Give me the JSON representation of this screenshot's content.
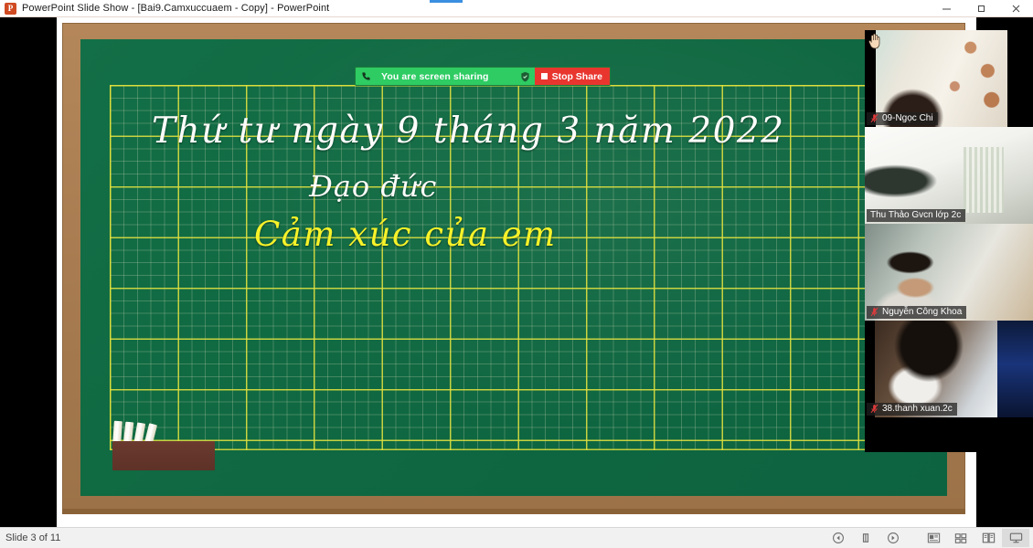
{
  "window": {
    "app_icon": "powerpoint-icon",
    "title": "PowerPoint Slide Show  -  [Bai9.Camxuccuaem - Copy] - PowerPoint",
    "minimize_label": "Minimize",
    "restore_label": "Restore",
    "close_label": "Close"
  },
  "share_toolbar": {
    "phone_icon": "phone-icon",
    "status_text": "You are screen sharing",
    "shield_icon": "shield-icon",
    "stop_label": "Stop Share",
    "green_color": "#2ecc63",
    "red_color": "#e8362f"
  },
  "slide": {
    "line1": "Thứ tư ngày 9 tháng 3 năm 2022",
    "line2": "Đạo đức",
    "line3": "Cảm xúc của em",
    "line1_color": "#fdfdfb",
    "line2_color": "#fdfdfb",
    "line3_color": "#f7f229",
    "board_color": "#0f6a42",
    "frame_color": "#a87c50",
    "grid_color": "#e1e13c"
  },
  "participants": [
    {
      "name": "09-Ngọc Chi",
      "mic_icon": "mic-muted-icon",
      "hand_icon": "raised-hand-icon",
      "raised_hand": true,
      "active_speaker": false
    },
    {
      "name": "Thu Thảo Gvcn lớp 2c",
      "mic_icon": "",
      "hand_icon": "",
      "raised_hand": false,
      "active_speaker": true
    },
    {
      "name": "Nguyễn Công Khoa",
      "mic_icon": "mic-muted-icon",
      "hand_icon": "",
      "raised_hand": false,
      "active_speaker": true
    },
    {
      "name": "38.thanh xuan.2c",
      "mic_icon": "mic-muted-icon",
      "hand_icon": "",
      "raised_hand": false,
      "active_speaker": false
    }
  ],
  "statusbar": {
    "slide_text": "Slide 3 of 11",
    "icons": [
      {
        "name": "previous-slide-icon",
        "label": "Previous"
      },
      {
        "name": "pen-menu-icon",
        "label": "Pen"
      },
      {
        "name": "next-slide-icon",
        "label": "Next"
      },
      {
        "name": "normal-view-icon",
        "label": "Normal View"
      },
      {
        "name": "slide-sorter-icon",
        "label": "Slide Sorter"
      },
      {
        "name": "reading-view-icon",
        "label": "Reading View"
      },
      {
        "name": "slideshow-view-icon",
        "label": "Slide Show"
      }
    ]
  }
}
